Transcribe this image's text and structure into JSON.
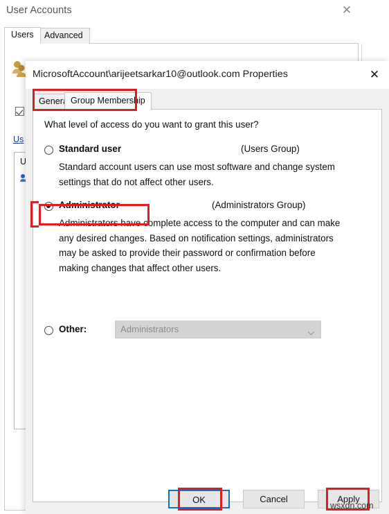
{
  "background_window": {
    "title": "User Accounts",
    "close_label": "✕",
    "tabs": [
      {
        "label": "Users",
        "active": true
      },
      {
        "label": "Advanced",
        "active": false
      }
    ],
    "link_text": "Us",
    "list_header": "U",
    "checkbox_checked": true
  },
  "dialog": {
    "title": "MicrosoftAccount\\arijeetsarkar10@outlook.com Properties",
    "close_label": "✕",
    "tabs": [
      {
        "label": "General",
        "active": false
      },
      {
        "label": "Group Membership",
        "active": true
      }
    ],
    "question": "What level of access do you want to grant this user?",
    "options": [
      {
        "label": "Standard user",
        "group": "(Users Group)",
        "description": "Standard account users can use most software and change system settings that do not affect other users.",
        "selected": false
      },
      {
        "label": "Administrator",
        "group": "(Administrators Group)",
        "description": "Administrators have complete access to the computer and can make any desired changes. Based on notification settings, administrators may be asked to provide their password or confirmation before making changes that affect other users.",
        "selected": true
      },
      {
        "label": "Other:",
        "group": "",
        "description": "",
        "selected": false
      }
    ],
    "other_combo": {
      "value": "Administrators",
      "enabled": false,
      "arrow": "chevron-down"
    },
    "buttons": {
      "ok": "OK",
      "cancel": "Cancel",
      "apply": "Apply"
    }
  },
  "annotations": {
    "color": "#d81f26",
    "focus_color": "#0b72c4",
    "highlighted": [
      "Group Membership",
      "Administrator",
      "OK",
      "Apply"
    ]
  },
  "watermark": "wsxdn.com"
}
